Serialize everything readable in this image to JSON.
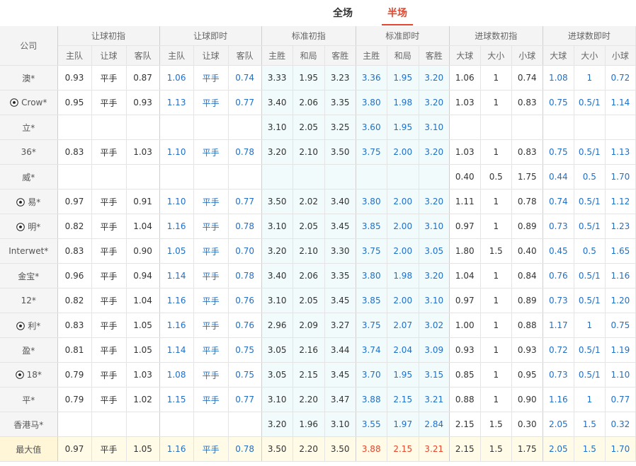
{
  "tabs": {
    "full": "全场",
    "half": "半场"
  },
  "headers": {
    "company": "公司",
    "groups": [
      "让球初指",
      "让球即时",
      "标准初指",
      "标准即时",
      "进球数初指",
      "进球数即时"
    ],
    "sub": [
      [
        "主队",
        "让球",
        "客队"
      ],
      [
        "主队",
        "让球",
        "客队"
      ],
      [
        "主胜",
        "和局",
        "客胜"
      ],
      [
        "主胜",
        "和局",
        "客胜"
      ],
      [
        "大球",
        "大小",
        "小球"
      ],
      [
        "大球",
        "大小",
        "小球"
      ]
    ]
  },
  "rows": [
    {
      "name": "澳*",
      "ball": false,
      "v": [
        [
          "0.93",
          "平手",
          "0.87"
        ],
        [
          "1.06",
          "平手",
          "0.74"
        ],
        [
          "3.33",
          "1.95",
          "3.23"
        ],
        [
          "3.36",
          "1.95",
          "3.20"
        ],
        [
          "1.06",
          "1",
          "0.74"
        ],
        [
          "1.08",
          "1",
          "0.72"
        ]
      ]
    },
    {
      "name": "Crow*",
      "ball": true,
      "v": [
        [
          "0.95",
          "平手",
          "0.93"
        ],
        [
          "1.13",
          "平手",
          "0.77"
        ],
        [
          "3.40",
          "2.06",
          "3.35"
        ],
        [
          "3.80",
          "1.98",
          "3.20"
        ],
        [
          "1.03",
          "1",
          "0.83"
        ],
        [
          "0.75",
          "0.5/1",
          "1.14"
        ]
      ]
    },
    {
      "name": "立*",
      "ball": false,
      "v": [
        [
          "",
          "",
          ""
        ],
        [
          "",
          "",
          ""
        ],
        [
          "3.10",
          "2.05",
          "3.25"
        ],
        [
          "3.60",
          "1.95",
          "3.10"
        ],
        [
          "",
          "",
          ""
        ],
        [
          "",
          "",
          ""
        ]
      ]
    },
    {
      "name": "36*",
      "ball": false,
      "v": [
        [
          "0.83",
          "平手",
          "1.03"
        ],
        [
          "1.10",
          "平手",
          "0.78"
        ],
        [
          "3.20",
          "2.10",
          "3.50"
        ],
        [
          "3.75",
          "2.00",
          "3.20"
        ],
        [
          "1.03",
          "1",
          "0.83"
        ],
        [
          "0.75",
          "0.5/1",
          "1.13"
        ]
      ]
    },
    {
      "name": "威*",
      "ball": false,
      "v": [
        [
          "",
          "",
          ""
        ],
        [
          "",
          "",
          ""
        ],
        [
          "",
          "",
          ""
        ],
        [
          "",
          "",
          ""
        ],
        [
          "0.40",
          "0.5",
          "1.75"
        ],
        [
          "0.44",
          "0.5",
          "1.70"
        ]
      ]
    },
    {
      "name": "易*",
      "ball": true,
      "v": [
        [
          "0.97",
          "平手",
          "0.91"
        ],
        [
          "1.10",
          "平手",
          "0.77"
        ],
        [
          "3.50",
          "2.02",
          "3.40"
        ],
        [
          "3.80",
          "2.00",
          "3.20"
        ],
        [
          "1.11",
          "1",
          "0.78"
        ],
        [
          "0.74",
          "0.5/1",
          "1.12"
        ]
      ]
    },
    {
      "name": "明*",
      "ball": true,
      "v": [
        [
          "0.82",
          "平手",
          "1.04"
        ],
        [
          "1.16",
          "平手",
          "0.78"
        ],
        [
          "3.10",
          "2.05",
          "3.45"
        ],
        [
          "3.85",
          "2.00",
          "3.10"
        ],
        [
          "0.97",
          "1",
          "0.89"
        ],
        [
          "0.73",
          "0.5/1",
          "1.23"
        ]
      ]
    },
    {
      "name": "Interwet*",
      "ball": false,
      "v": [
        [
          "0.83",
          "平手",
          "0.90"
        ],
        [
          "1.05",
          "平手",
          "0.70"
        ],
        [
          "3.20",
          "2.10",
          "3.30"
        ],
        [
          "3.75",
          "2.00",
          "3.05"
        ],
        [
          "1.80",
          "1.5",
          "0.40"
        ],
        [
          "0.45",
          "0.5",
          "1.65"
        ]
      ]
    },
    {
      "name": "金宝*",
      "ball": false,
      "v": [
        [
          "0.96",
          "平手",
          "0.94"
        ],
        [
          "1.14",
          "平手",
          "0.78"
        ],
        [
          "3.40",
          "2.06",
          "3.35"
        ],
        [
          "3.80",
          "1.98",
          "3.20"
        ],
        [
          "1.04",
          "1",
          "0.84"
        ],
        [
          "0.76",
          "0.5/1",
          "1.16"
        ]
      ]
    },
    {
      "name": "12*",
      "ball": false,
      "v": [
        [
          "0.82",
          "平手",
          "1.04"
        ],
        [
          "1.16",
          "平手",
          "0.76"
        ],
        [
          "3.10",
          "2.05",
          "3.45"
        ],
        [
          "3.85",
          "2.00",
          "3.10"
        ],
        [
          "0.97",
          "1",
          "0.89"
        ],
        [
          "0.73",
          "0.5/1",
          "1.20"
        ]
      ]
    },
    {
      "name": "利*",
      "ball": true,
      "v": [
        [
          "0.83",
          "平手",
          "1.05"
        ],
        [
          "1.16",
          "平手",
          "0.76"
        ],
        [
          "2.96",
          "2.09",
          "3.27"
        ],
        [
          "3.75",
          "2.07",
          "3.02"
        ],
        [
          "1.00",
          "1",
          "0.88"
        ],
        [
          "1.17",
          "1",
          "0.75"
        ]
      ]
    },
    {
      "name": "盈*",
      "ball": false,
      "v": [
        [
          "0.81",
          "平手",
          "1.05"
        ],
        [
          "1.14",
          "平手",
          "0.75"
        ],
        [
          "3.05",
          "2.16",
          "3.44"
        ],
        [
          "3.74",
          "2.04",
          "3.09"
        ],
        [
          "0.93",
          "1",
          "0.93"
        ],
        [
          "0.72",
          "0.5/1",
          "1.19"
        ]
      ]
    },
    {
      "name": "18*",
      "ball": true,
      "v": [
        [
          "0.79",
          "平手",
          "1.03"
        ],
        [
          "1.08",
          "平手",
          "0.75"
        ],
        [
          "3.05",
          "2.15",
          "3.45"
        ],
        [
          "3.70",
          "1.95",
          "3.15"
        ],
        [
          "0.85",
          "1",
          "0.95"
        ],
        [
          "0.73",
          "0.5/1",
          "1.10"
        ]
      ]
    },
    {
      "name": "平*",
      "ball": false,
      "v": [
        [
          "0.79",
          "平手",
          "1.02"
        ],
        [
          "1.15",
          "平手",
          "0.77"
        ],
        [
          "3.10",
          "2.20",
          "3.47"
        ],
        [
          "3.88",
          "2.15",
          "3.21"
        ],
        [
          "0.88",
          "1",
          "0.90"
        ],
        [
          "1.16",
          "1",
          "0.77"
        ]
      ]
    },
    {
      "name": "香港马*",
      "ball": false,
      "v": [
        [
          "",
          "",
          ""
        ],
        [
          "",
          "",
          ""
        ],
        [
          "3.20",
          "1.96",
          "3.10"
        ],
        [
          "3.55",
          "1.97",
          "2.84"
        ],
        [
          "2.15",
          "1.5",
          "0.30"
        ],
        [
          "2.05",
          "1.5",
          "0.32"
        ]
      ]
    }
  ],
  "max_row": {
    "name": "最大值",
    "v": [
      [
        "0.97",
        "平手",
        "1.05"
      ],
      [
        "1.16",
        "平手",
        "0.78"
      ],
      [
        "3.50",
        "2.20",
        "3.50"
      ],
      [
        "3.88",
        "2.15",
        "3.21"
      ],
      [
        "2.15",
        "1.5",
        "1.75"
      ],
      [
        "2.05",
        "1.5",
        "1.70"
      ]
    ]
  },
  "colors": {
    "accent": "#e4462e",
    "blue": "#1f6fc9",
    "mint": "#f1fbfb",
    "max_bg": "#fffbe6"
  }
}
